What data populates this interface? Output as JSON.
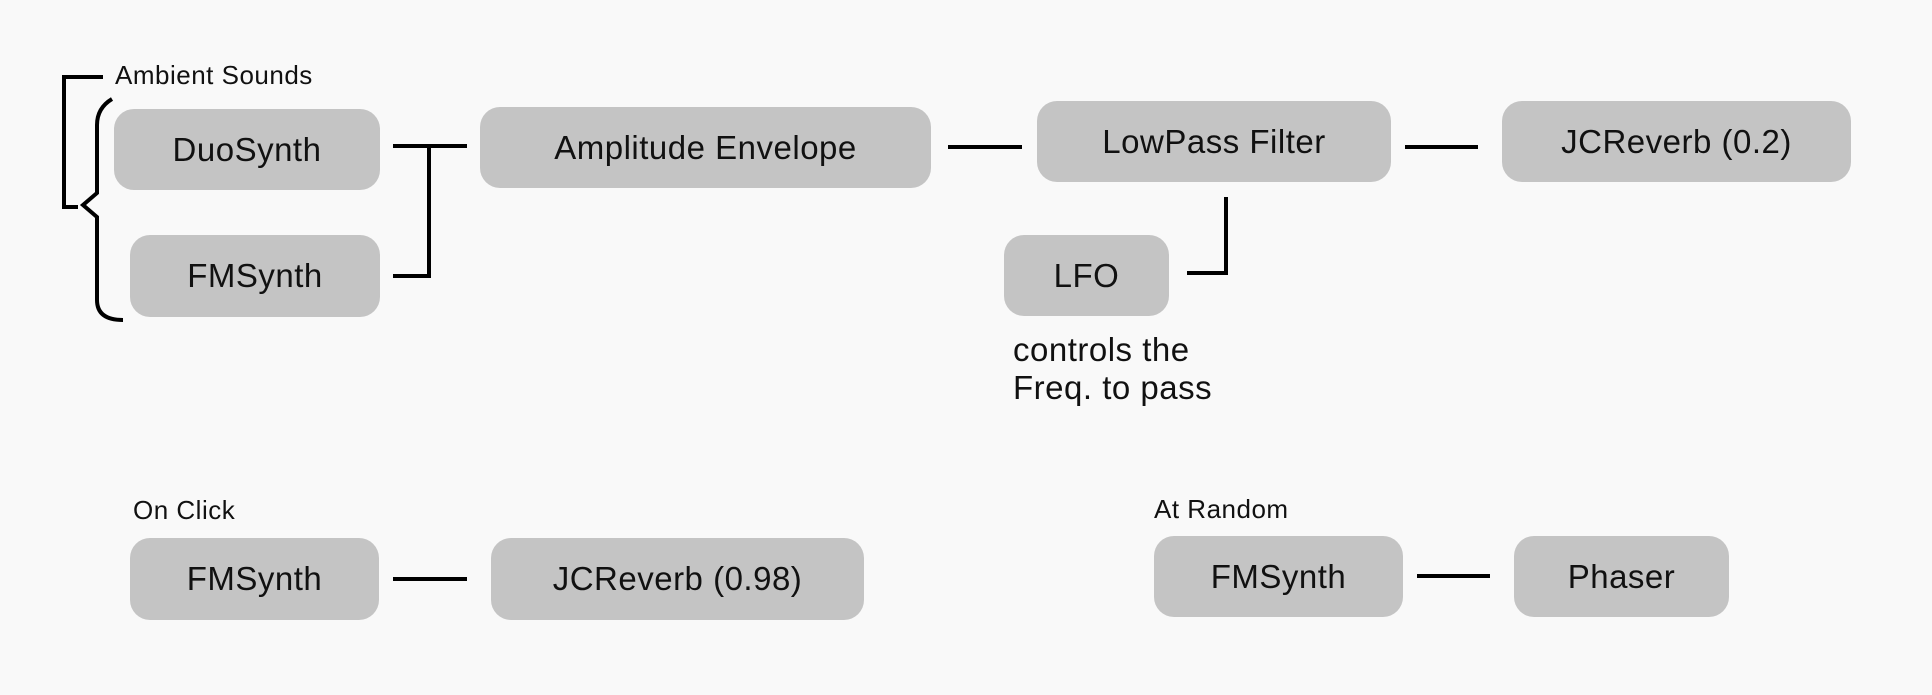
{
  "diagram": {
    "groups": [
      {
        "id": "ambient",
        "label": "Ambient Sounds",
        "nodes": {
          "duosynth": "DuoSynth",
          "fmsynth": "FMSynth",
          "amp_env": "Amplitude Envelope",
          "lowpass": "LowPass Filter",
          "jcreverb": "JCReverb (0.2)",
          "lfo": "LFO"
        },
        "note": [
          "controls the",
          "Freq. to pass"
        ],
        "edges": [
          [
            "DuoSynth",
            "Amplitude Envelope"
          ],
          [
            "FMSynth",
            "Amplitude Envelope"
          ],
          [
            "Amplitude Envelope",
            "LowPass Filter"
          ],
          [
            "LowPass Filter",
            "JCReverb (0.2)"
          ],
          [
            "LFO",
            "LowPass Filter"
          ]
        ]
      },
      {
        "id": "onclick",
        "label": "On Click",
        "nodes": {
          "fmsynth": "FMSynth",
          "jcreverb": "JCReverb (0.98)"
        },
        "edges": [
          [
            "FMSynth",
            "JCReverb (0.98)"
          ]
        ]
      },
      {
        "id": "random",
        "label": "At Random",
        "nodes": {
          "fmsynth": "FMSynth",
          "phaser": "Phaser"
        },
        "edges": [
          [
            "FMSynth",
            "Phaser"
          ]
        ]
      }
    ],
    "colors": {
      "background": "#f9f9f9",
      "node_fill": "#c4c4c4",
      "line": "#000000",
      "text": "#111111"
    }
  }
}
